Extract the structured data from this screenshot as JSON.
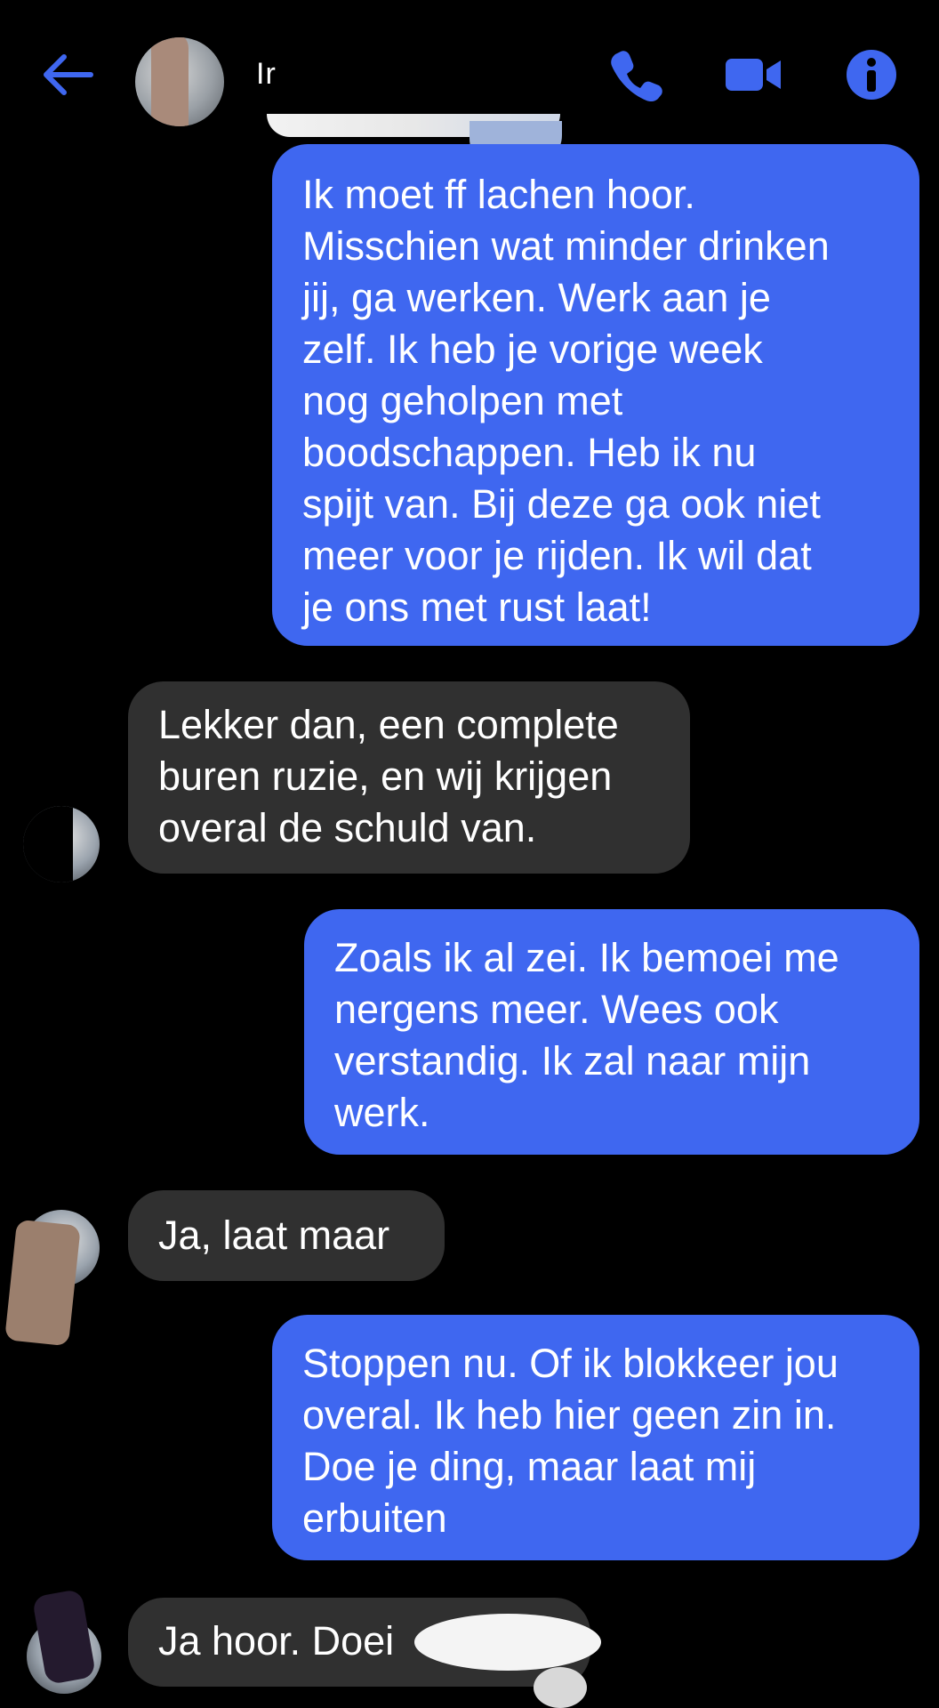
{
  "header": {
    "contact_name": "Ir",
    "colors": {
      "accent": "#3f67f0",
      "background": "#000000"
    },
    "icons": [
      "back-arrow-icon",
      "phone-icon",
      "video-camera-icon",
      "info-icon"
    ]
  },
  "messages": [
    {
      "direction": "sent",
      "text": "Ik moet ff lachen hoor.\nMisschien wat minder drinken\njij, ga werken. Werk aan je\nzelf.  Ik heb je vorige week\nnog geholpen met\nboodschappen.  Heb ik nu\nspijt van. Bij deze ga ook niet\nmeer voor je rijden. Ik wil dat\nje ons met rust laat!"
    },
    {
      "direction": "received",
      "text": "Lekker dan, een complete\nburen ruzie, en wij krijgen\noveral de schuld van."
    },
    {
      "direction": "sent",
      "text": "Zoals ik al zei. Ik bemoei me\nnergens meer. Wees ook\nverstandig.  Ik zal naar mijn\nwerk."
    },
    {
      "direction": "received",
      "text": "Ja, laat maar"
    },
    {
      "direction": "sent",
      "text": "Stoppen nu. Of ik blokkeer jou\noveral.  Ik heb hier geen zin in.\nDoe je ding, maar laat mij\nerbuiten"
    },
    {
      "direction": "received",
      "text": "Ja hoor. Doei"
    }
  ],
  "bubble_colors": {
    "sent": "#3f67f0",
    "received": "#303030"
  }
}
